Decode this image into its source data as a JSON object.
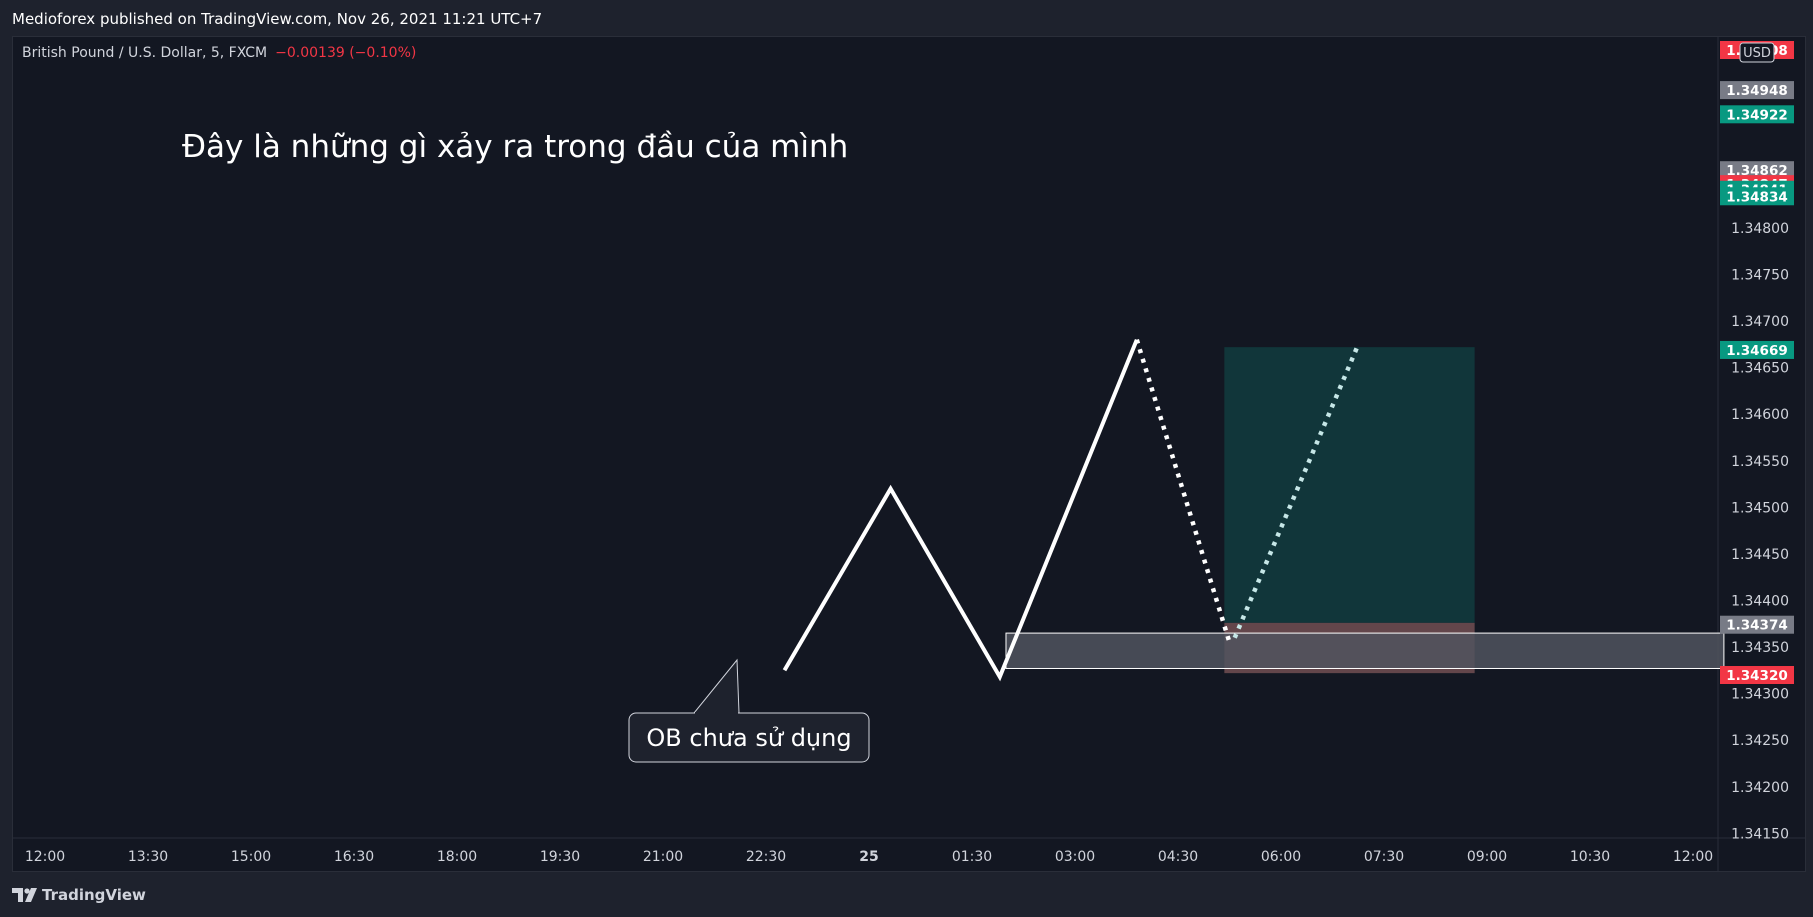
{
  "header": {
    "publisher_line": "Medioforex published on TradingView.com, Nov 26, 2021 11:21 UTC+7"
  },
  "symbol": {
    "name": "British Pound / U.S. Dollar, 5, FXCM",
    "change": "−0.00139 (−0.10%)"
  },
  "colors": {
    "background": "#131722",
    "frame": "#1e222d",
    "text": "#d1d4dc",
    "red": "#f23645",
    "green": "#089981",
    "gray_tag": "#787b86",
    "profit_zone": "#11363a",
    "loss_zone": "#6d4b50",
    "ob_zone": "#50535e"
  },
  "chart_data": {
    "type": "line",
    "title": "Đây là những gì xảy ra trong đầu của mình",
    "annotation": "OB chưa sử dụng",
    "currency": "USD",
    "x_ticks": [
      "12:00",
      "13:30",
      "15:00",
      "16:30",
      "18:00",
      "19:30",
      "21:00",
      "22:30",
      "25",
      "01:30",
      "03:00",
      "04:30",
      "06:00",
      "07:30",
      "09:00",
      "10:30",
      "12:00"
    ],
    "y_ticks": [
      "1.34800",
      "1.34750",
      "1.34700",
      "1.34650",
      "1.34600",
      "1.34550",
      "1.34500",
      "1.34450",
      "1.34400",
      "1.34350",
      "1.34300",
      "1.34250",
      "1.34200",
      "1.34150"
    ],
    "ylim": [
      1.34145,
      1.35005
    ],
    "xlim": [
      0,
      16.5
    ],
    "series": [
      {
        "style": "solid",
        "color": "#ffffff",
        "points": [
          [
            7.18,
            1.34325
          ],
          [
            8.21,
            1.3452
          ],
          [
            9.27,
            1.34318
          ],
          [
            10.6,
            1.3468
          ]
        ]
      },
      {
        "style": "dotted",
        "color": "#ffffff",
        "points": [
          [
            10.6,
            1.3468
          ],
          [
            11.5,
            1.34355
          ]
        ]
      },
      {
        "style": "dotted",
        "color": "#c6e7e7",
        "points": [
          [
            11.55,
            1.3436
          ],
          [
            12.75,
            1.34675
          ]
        ]
      }
    ],
    "zones": [
      {
        "kind": "profit",
        "x": [
          11.45,
          13.88
        ],
        "y": [
          1.34376,
          1.34672
        ]
      },
      {
        "kind": "loss",
        "x": [
          11.45,
          13.88
        ],
        "y": [
          1.34322,
          1.34376
        ]
      },
      {
        "kind": "order_block",
        "x": [
          9.33,
          16.3
        ],
        "y": [
          1.34327,
          1.34365
        ]
      }
    ],
    "price_tags": [
      {
        "label": "1.35008",
        "value": 1.35008,
        "color": "#f23645"
      },
      {
        "label": "1.34948",
        "value": 1.34948,
        "color": "#787b86"
      },
      {
        "label": "1.34922",
        "value": 1.34922,
        "color": "#089981"
      },
      {
        "label": "1.34862",
        "value": 1.34862,
        "color": "#787b86"
      },
      {
        "label": "1.34847",
        "value": 1.34847,
        "color": "#f23645"
      },
      {
        "label": "1.34841",
        "value": 1.34841,
        "color": "#089981"
      },
      {
        "label": "1.34834",
        "value": 1.34834,
        "color": "#089981"
      },
      {
        "label": "1.34669",
        "value": 1.34669,
        "color": "#089981"
      },
      {
        "label": "1.34374",
        "value": 1.34374,
        "color": "#787b86"
      },
      {
        "label": "1.34320",
        "value": 1.3432,
        "color": "#f23645"
      }
    ]
  },
  "footer": {
    "brand": "TradingView"
  }
}
